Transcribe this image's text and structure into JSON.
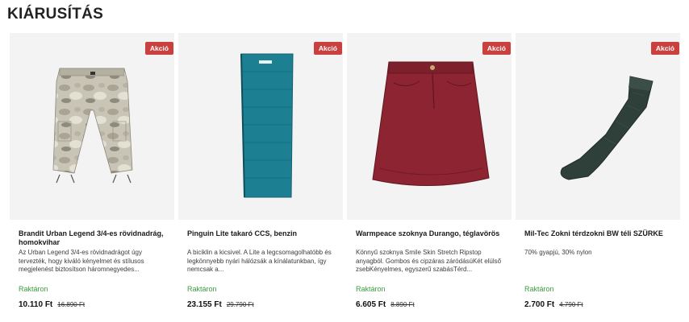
{
  "section": {
    "title": "KIÁRUSÍTÁS"
  },
  "products": [
    {
      "badge": "Akció",
      "name": "Brandit Urban Legend 3/4-es rövidnadrág, homokvihar",
      "description": "Az Urban Legend 3/4-es rövidnadrágot úgy tervezték, hogy kiváló kényelmet és stílusos megjelenést biztosítson háromnegyedes...",
      "stock": "Raktáron",
      "price": "10.110 Ft",
      "old_price": "16.890 Ft",
      "image_icon": "camo-shorts-image"
    },
    {
      "badge": "Akció",
      "name": "Pinguin Lite takaró CCS, benzin",
      "description": "A biciklin a kicsivel. A Lite a legcsomagolhatóbb és legkönnyebb nyári hálózsák a kínálatunkban, így nemcsak a...",
      "stock": "Raktáron",
      "price": "23.155 Ft",
      "old_price": "29.790 Ft",
      "image_icon": "sleeping-bag-image"
    },
    {
      "badge": "Akció",
      "name": "Warmpeace szoknya Durango, téglavörös",
      "description": "Könnyű szoknya Smile Skin Stretch Ripstop anyagból. Gombos és cipzáras záródásúKét elülső zsebKényelmes, egyszerű szabásTérd...",
      "stock": "Raktáron",
      "price": "6.605 Ft",
      "old_price": "8.890 Ft",
      "image_icon": "skirt-image"
    },
    {
      "badge": "Akció",
      "name": "Mil-Tec Zokni térdzokni BW téli SZÜRKE",
      "description": "70% gyapjú, 30% nylon",
      "stock": "Raktáron",
      "price": "2.700 Ft",
      "old_price": "4.790 Ft",
      "image_icon": "sock-image"
    }
  ]
}
